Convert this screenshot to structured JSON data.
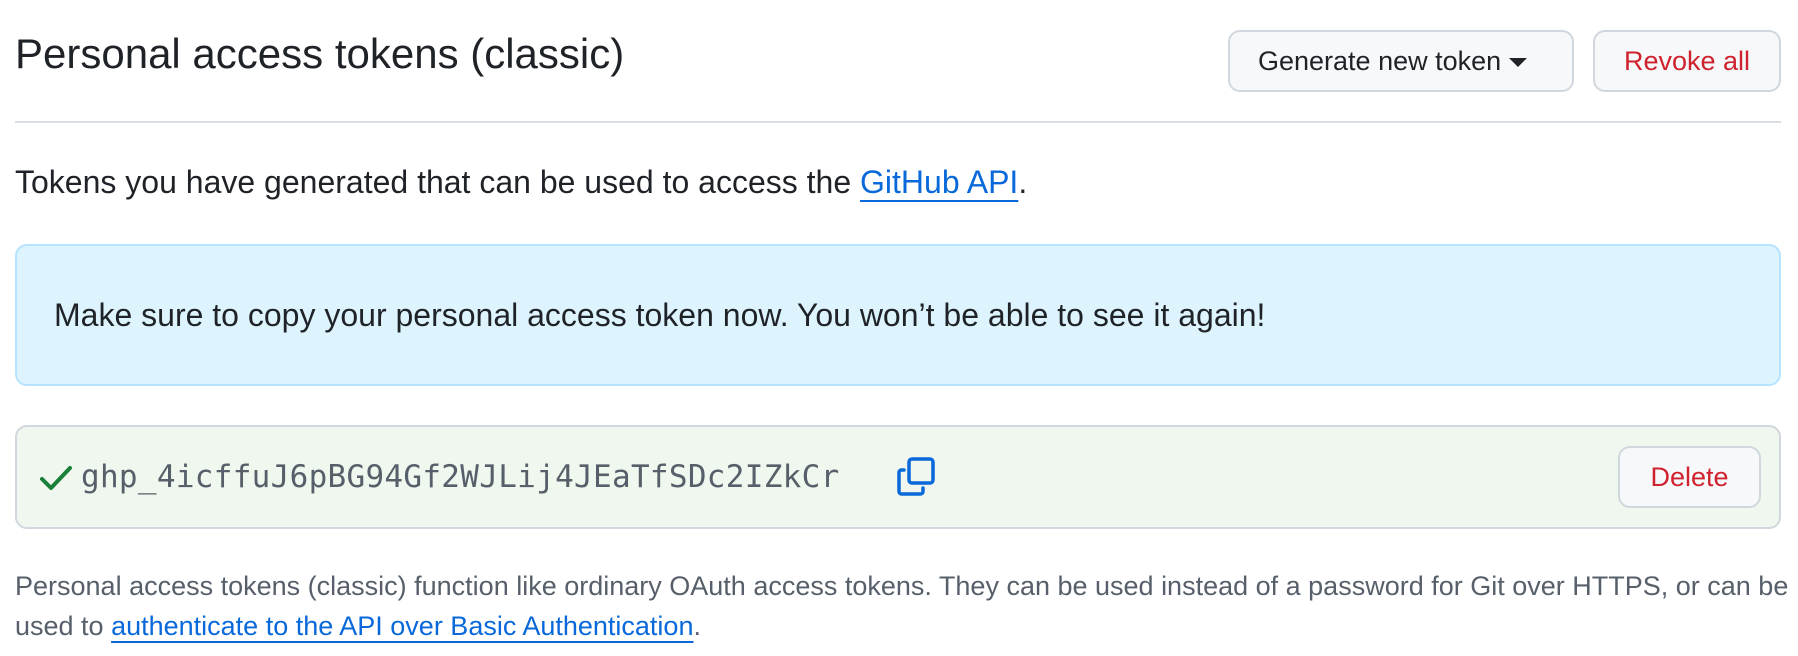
{
  "header": {
    "title": "Personal access tokens (classic)",
    "generate_label": "Generate new token",
    "revoke_label": "Revoke all"
  },
  "intro": {
    "text": "Tokens you have generated that can be used to access the ",
    "link": "GitHub API",
    "suffix": "."
  },
  "flash": {
    "message": "Make sure to copy your personal access token now. You won’t be able to see it again!"
  },
  "token": {
    "value": "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",
    "status_icon": "check-icon",
    "copy_icon": "copy-icon",
    "delete_label": "Delete"
  },
  "footnote": {
    "text": "Personal access tokens (classic) function like ordinary OAuth access tokens. They can be used instead of a password for Git over HTTPS, or can be used to ",
    "link": "authenticate to the API over Basic Authentication",
    "suffix": "."
  },
  "colors": {
    "accent": "#0969da",
    "danger": "#cf222e",
    "success": "#1a7f37",
    "info_bg": "#ddf4ff",
    "token_bg": "#f0f7ee"
  }
}
